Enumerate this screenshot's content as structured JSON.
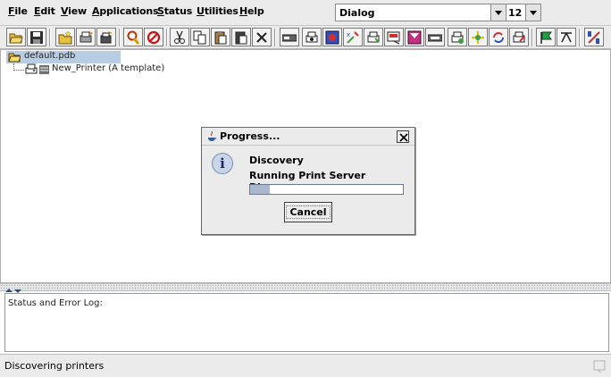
{
  "menubar": {
    "items": [
      {
        "mnemonic": "F",
        "rest": "ile"
      },
      {
        "mnemonic": "E",
        "rest": "dit"
      },
      {
        "mnemonic": "V",
        "rest": "iew"
      },
      {
        "mnemonic": "A",
        "rest": "pplications"
      },
      {
        "mnemonic": "S",
        "rest": "tatus"
      },
      {
        "mnemonic": "U",
        "rest": "tilities"
      },
      {
        "mnemonic": "H",
        "rest": "elp"
      }
    ],
    "font_value": "Dialog",
    "size_value": "12"
  },
  "toolbar": {
    "icons": [
      "open-folder-icon",
      "save-icon",
      "new-folder-icon",
      "new-printer-icon",
      "new-item-icon",
      "find-icon",
      "stop-icon",
      "cut-icon",
      "copy-icon",
      "paste-icon",
      "paste-special-icon",
      "delete-icon",
      "device-icon",
      "printer-settings-icon",
      "driver-icon",
      "tool-icon",
      "printer-config-icon",
      "queue-icon",
      "filter-icon",
      "device-bar-icon",
      "printer-network-icon",
      "compass-icon",
      "refresh-icon",
      "printer-edit-icon",
      "flag-icon",
      "transfer-icon",
      "split-icon"
    ]
  },
  "tree": {
    "root_label": "default.pdb",
    "child_label": "New_Printer (A template)"
  },
  "log": {
    "label": "Status and Error Log:"
  },
  "statusbar": {
    "text": "Discovering printers"
  },
  "dialog": {
    "title": "Progress...",
    "heading": "Discovery",
    "message": "Running Print Server Discovery",
    "progress": 0.13,
    "cancel_label": "Cancel"
  },
  "colors": {
    "chrome": "#ebebeb",
    "selection": "#b8cde4",
    "progress_fill": "#a8b8d0"
  }
}
